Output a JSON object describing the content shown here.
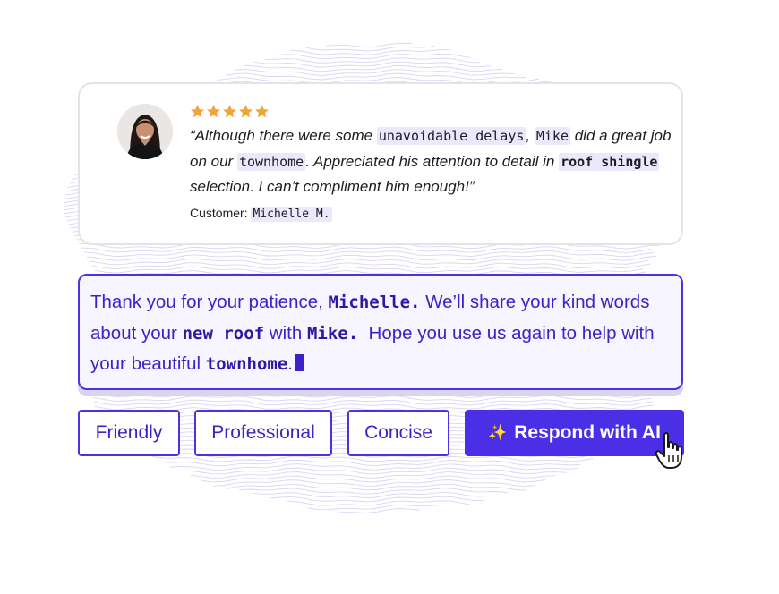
{
  "review": {
    "rating": 5,
    "quote": {
      "open": "“Although there were some ",
      "h1": "unavoidable delays",
      "t2": ", ",
      "h2": "Mike",
      "t3": " did a great job on our ",
      "h3": "townhome",
      "t4": ". Appreciated his attention to detail in ",
      "h4": "roof shingle",
      "t5": " selection. I can’t compliment him enough!”"
    },
    "customer_label": "Customer:",
    "customer_name": "Michelle M."
  },
  "response": {
    "t1": "Thank you for your patience, ",
    "b1": "Michelle.",
    "t2": " We’ll share your kind words about your ",
    "b2": "new roof",
    "t3": " with ",
    "b3": "Mike.",
    "t4": "  Hope you use us again to help with your beautiful ",
    "b4": "townhome",
    "t5": "."
  },
  "buttons": {
    "friendly": "Friendly",
    "professional": "Professional",
    "concise": "Concise",
    "ai": "Respond with AI"
  },
  "icons": {
    "star": "star-icon",
    "sparkle": "sparkle-icon",
    "cursor": "hand-pointer-icon"
  },
  "colors": {
    "accent": "#4a33e4",
    "star": "#f0a43a",
    "highlight": "#ece8fb"
  }
}
